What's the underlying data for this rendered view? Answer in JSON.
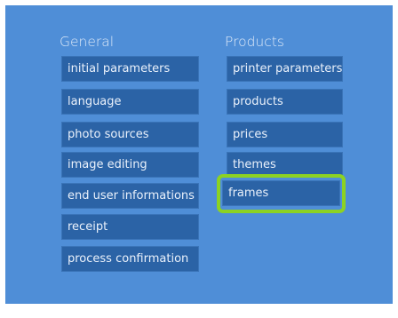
{
  "general": {
    "title": "General",
    "items": [
      {
        "label": "initial parameters"
      },
      {
        "label": "language"
      },
      {
        "label": "photo sources"
      },
      {
        "label": "image editing"
      },
      {
        "label": "end user informations"
      },
      {
        "label": "receipt"
      },
      {
        "label": "process confirmation"
      }
    ]
  },
  "products": {
    "title": "Products",
    "items": [
      {
        "label": "printer parameters"
      },
      {
        "label": "products"
      },
      {
        "label": "prices"
      },
      {
        "label": "themes"
      },
      {
        "label": "frames",
        "highlighted": true
      }
    ]
  },
  "colors": {
    "background": "#4f8ed7",
    "tile": "#2b63a6",
    "highlight": "#8cd223"
  }
}
